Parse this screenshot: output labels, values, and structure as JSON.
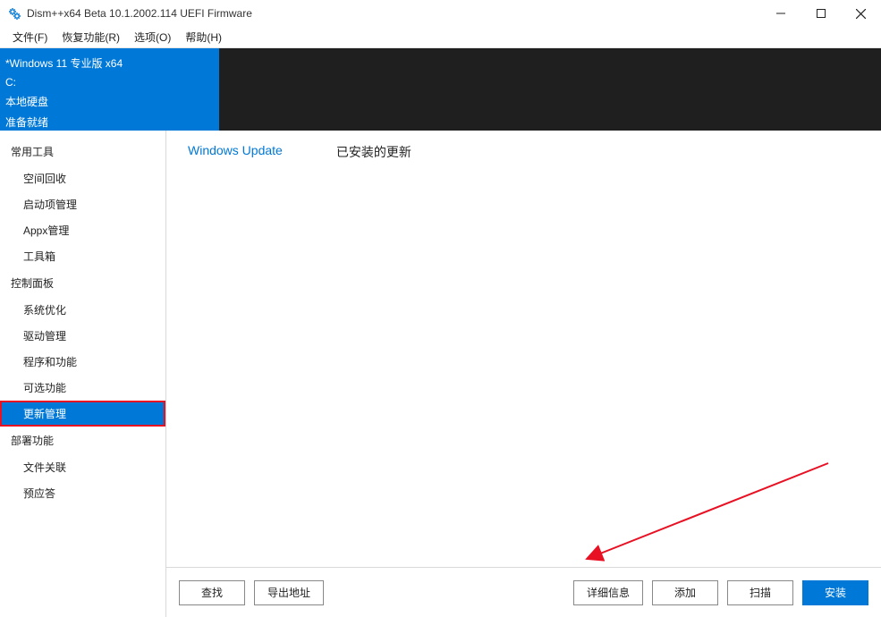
{
  "titlebar": {
    "title": "Dism++x64 Beta 10.1.2002.114 UEFI Firmware"
  },
  "menubar": {
    "file": "文件(F)",
    "recovery": "恢复功能(R)",
    "options": "选项(O)",
    "help": "帮助(H)"
  },
  "infobar": {
    "line1": "*Windows 11 专业版 x64",
    "line2": "C:",
    "line3": "本地硬盘",
    "line4": "准备就绪"
  },
  "sidebar": {
    "group1": "常用工具",
    "g1_items": [
      "空间回收",
      "启动项管理",
      "Appx管理",
      "工具箱"
    ],
    "group2": "控制面板",
    "g2_items": [
      "系统优化",
      "驱动管理",
      "程序和功能",
      "可选功能",
      "更新管理"
    ],
    "group3": "部署功能",
    "g3_items": [
      "文件关联",
      "预应答"
    ]
  },
  "tabs": {
    "windows_update": "Windows Update",
    "installed": "已安装的更新"
  },
  "buttons": {
    "find": "查找",
    "export": "导出地址",
    "details": "详细信息",
    "add": "添加",
    "scan": "扫描",
    "install": "安装"
  }
}
